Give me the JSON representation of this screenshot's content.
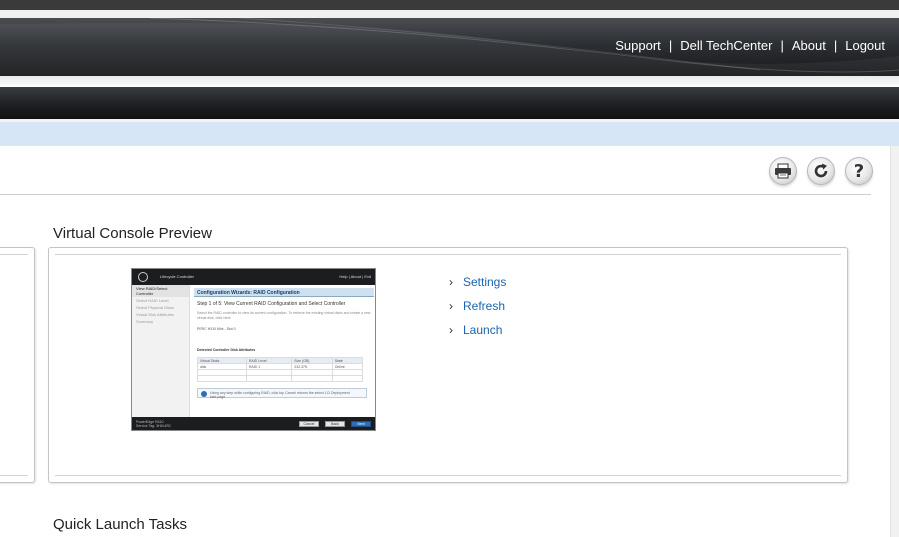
{
  "header": {
    "links": [
      {
        "label": "Support"
      },
      {
        "label": "Dell TechCenter"
      },
      {
        "label": "About"
      },
      {
        "label": "Logout"
      }
    ],
    "separator": "|"
  },
  "toolbar": {
    "icons": [
      "print-icon",
      "refresh-icon",
      "help-icon"
    ]
  },
  "sections": {
    "virtual_console": {
      "title": "Virtual Console Preview",
      "links": [
        {
          "label": "Settings"
        },
        {
          "label": "Refresh"
        },
        {
          "label": "Launch"
        }
      ]
    },
    "quick_launch": {
      "title": "Quick Launch Tasks"
    }
  },
  "preview": {
    "header_text": "Lifecycle Controller",
    "header_links": "Help | About | Exit",
    "sidebar": [
      "View RAID/Select Controller",
      "Select RAID Level",
      "Select Physical Disks",
      "Virtual Disk Attributes",
      "Summary"
    ],
    "wizard_title": "Configuration Wizards: RAID Configuration",
    "step": "Step 1 of 5: View Current RAID Configuration and Select Controller",
    "description": "Select the RAID controller to view its current configuration. To retrieve the existing virtual disks and create a new virtual disk, click Next.",
    "controller_option": "PERC H310 Mini - Slot 0",
    "table_title": "Detected Controller Disk Attributes",
    "table_headers": [
      "Virtual Disks",
      "RAID Level",
      "Size (GB)",
      "State"
    ],
    "table_row": [
      "disk",
      "RAID 1",
      "232.375",
      "Online"
    ],
    "info": "Using any step while configuring RAID, click top Cancel returns the select LCi Deployment task page.",
    "footer_lines": [
      "PowerEdge R410",
      "Service Tag: 3H4L4R1"
    ],
    "buttons": [
      "Cancel",
      "Back",
      "Next"
    ]
  },
  "colors": {
    "link": "#1a64b0",
    "breadcrumb_bar": "#d7e6f6",
    "header_dark": "#17191c"
  }
}
